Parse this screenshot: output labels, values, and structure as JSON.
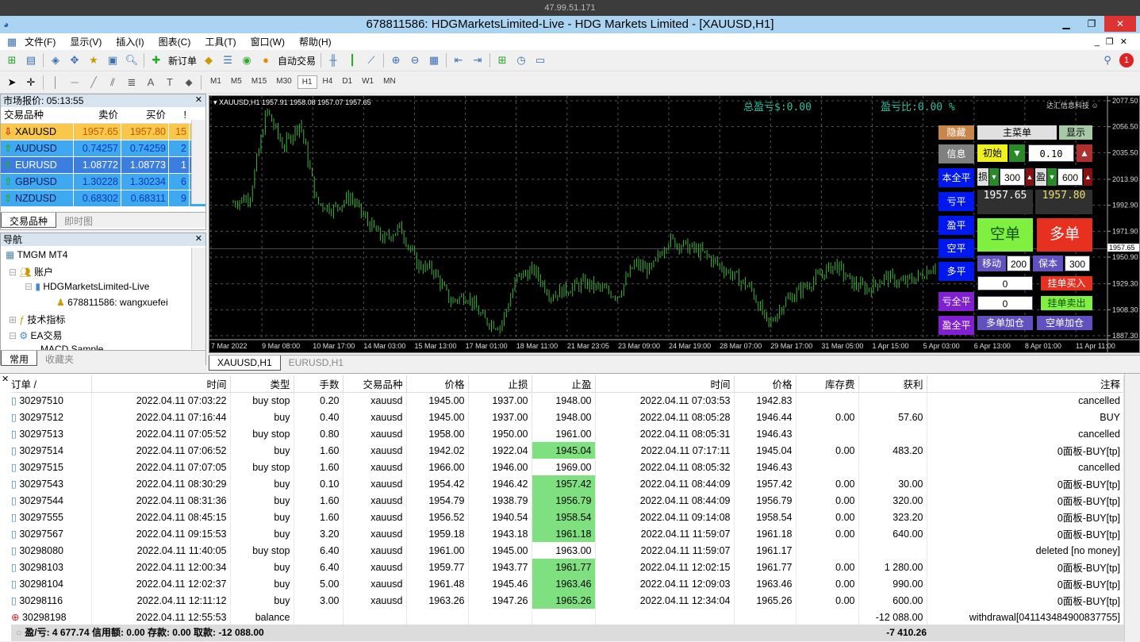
{
  "remote_ip": "47.99.51.171",
  "title": "678811586: HDGMarketsLimited-Live - HDG Markets Limited - [XAUUSD,H1]",
  "menu": [
    "文件(F)",
    "显示(V)",
    "插入(I)",
    "图表(C)",
    "工具(T)",
    "窗口(W)",
    "帮助(H)"
  ],
  "toolbar": {
    "new_order": "新订单",
    "auto_trade": "自动交易"
  },
  "timeframes": [
    "M1",
    "M5",
    "M15",
    "M30",
    "H1",
    "H4",
    "D1",
    "W1",
    "MN"
  ],
  "active_timeframe": "H1",
  "market_watch": {
    "title": "市场报价: 05:13:55",
    "headers": [
      "交易品种",
      "卖价",
      "买价",
      "!"
    ],
    "rows": [
      {
        "symbol": "XAUUSD",
        "bid": "1957.65",
        "ask": "1957.80",
        "spread": "15",
        "dir": "down"
      },
      {
        "symbol": "AUDUSD",
        "bid": "0.74257",
        "ask": "0.74259",
        "spread": "2",
        "dir": "up"
      },
      {
        "symbol": "EURUSD",
        "bid": "1.08772",
        "ask": "1.08773",
        "spread": "1",
        "dir": "up"
      },
      {
        "symbol": "GBPUSD",
        "bid": "1.30228",
        "ask": "1.30234",
        "spread": "6",
        "dir": "up"
      },
      {
        "symbol": "NZDUSD",
        "bid": "0.68302",
        "ask": "0.68311",
        "spread": "9",
        "dir": "up"
      }
    ],
    "tabs": [
      "交易品种",
      "即时图"
    ]
  },
  "navigator": {
    "title": "导航",
    "items": [
      "TMGM MT4",
      "账户",
      "HDGMarketsLimited-Live",
      "678811586: wangxuefei",
      "技术指标",
      "EA交易",
      "MACD Sample"
    ],
    "tabs": [
      "常用",
      "收藏夹"
    ]
  },
  "chart": {
    "info": "XAUUSD,H1  1957.91 1958.08 1957.07 1957.65",
    "total_pl": "总盈亏$:0.00",
    "pl_ratio": "盈亏比:0.00 %",
    "brand": "达汇信息科技",
    "price_axis": [
      "2077.50",
      "2056.50",
      "2035.50",
      "2013.90",
      "1992.90",
      "1971.90",
      "1950.90",
      "1929.30",
      "1908.30",
      "1887.30"
    ],
    "current_price": "1957.65",
    "time_axis": [
      "7 Mar 2022",
      "9 Mar 08:00",
      "10 Mar 17:00",
      "14 Mar 03:00",
      "15 Mar 13:00",
      "17 Mar 01:00",
      "18 Mar 11:00",
      "21 Mar 23:05",
      "23 Mar 09:00",
      "24 Mar 19:00",
      "28 Mar 07:00",
      "29 Mar 17:00",
      "31 Mar 05:00",
      "1 Apr 15:00",
      "5 Apr 03:00",
      "6 Apr 13:00",
      "8 Apr 01:00",
      "11 Apr 11:00"
    ],
    "price_path": [
      1995,
      2000,
      2070,
      2040,
      2060,
      1995,
      1990,
      2000,
      1980,
      1965,
      1975,
      1945,
      1940,
      1915,
      1920,
      1900,
      1895,
      1935,
      1940,
      1920,
      1925,
      1930,
      1925,
      1920,
      1945,
      1940,
      1965,
      1960,
      1955,
      1945,
      1935,
      1925,
      1895,
      1915,
      1925,
      1935,
      1945,
      1930,
      1925,
      1935,
      1930,
      1935,
      1945
    ]
  },
  "ea_panel": {
    "hide": "隐藏",
    "main_menu": "主菜单",
    "show": "显示",
    "info": "信息",
    "initial": "初始",
    "lots": "0.10",
    "close_all_self": "本全平",
    "sl_label": "损",
    "sl": "300",
    "tp_label": "盈",
    "tp": "600",
    "bid": "1957.65",
    "ask": "1957.80",
    "close_loss": "亏平",
    "close_profit": "盈平",
    "close_short": "空平",
    "close_long": "多平",
    "sell": "空单",
    "buy": "多单",
    "trail_label": "移动",
    "trail": "200",
    "breakeven_label": "保本",
    "breakeven": "300",
    "pending_buy_value": "0",
    "pending_buy": "挂单买入",
    "pending_sell_value": "0",
    "pending_sell": "挂单卖出",
    "close_all_loss": "亏全平",
    "close_all_profit": "盈全平",
    "add_long": "多单加仓",
    "add_short": "空单加仓"
  },
  "chart_tabs": [
    "XAUUSD,H1",
    "EURUSD,H1"
  ],
  "terminal": {
    "headers": [
      "订单  /",
      "时间",
      "类型",
      "手数",
      "交易品种",
      "价格",
      "止损",
      "止盈",
      "时间",
      "价格",
      "库存费",
      "获利",
      "注释"
    ],
    "rows": [
      [
        "30297510",
        "2022.04.11 07:03:22",
        "buy stop",
        "0.20",
        "xauusd",
        "1945.00",
        "1937.00",
        "1948.00",
        "2022.04.11 07:03:53",
        "1942.83",
        "",
        "",
        "cancelled",
        false
      ],
      [
        "30297512",
        "2022.04.11 07:16:44",
        "buy",
        "0.40",
        "xauusd",
        "1945.00",
        "1937.00",
        "1948.00",
        "2022.04.11 08:05:28",
        "1946.44",
        "0.00",
        "57.60",
        "BUY",
        false
      ],
      [
        "30297513",
        "2022.04.11 07:05:52",
        "buy stop",
        "0.80",
        "xauusd",
        "1958.00",
        "1950.00",
        "1961.00",
        "2022.04.11 08:05:31",
        "1946.43",
        "",
        "",
        "cancelled",
        false
      ],
      [
        "30297514",
        "2022.04.11 07:06:52",
        "buy",
        "1.60",
        "xauusd",
        "1942.02",
        "1922.04",
        "1945.04",
        "2022.04.11 07:17:11",
        "1945.04",
        "0.00",
        "483.20",
        "0面板-BUY[tp]",
        true
      ],
      [
        "30297515",
        "2022.04.11 07:07:05",
        "buy stop",
        "1.60",
        "xauusd",
        "1966.00",
        "1946.00",
        "1969.00",
        "2022.04.11 08:05:32",
        "1946.43",
        "",
        "",
        "cancelled",
        false
      ],
      [
        "30297543",
        "2022.04.11 08:30:29",
        "buy",
        "0.10",
        "xauusd",
        "1954.42",
        "1946.42",
        "1957.42",
        "2022.04.11 08:44:09",
        "1957.42",
        "0.00",
        "30.00",
        "0面板-BUY[tp]",
        true
      ],
      [
        "30297544",
        "2022.04.11 08:31:36",
        "buy",
        "1.60",
        "xauusd",
        "1954.79",
        "1938.79",
        "1956.79",
        "2022.04.11 08:44:09",
        "1956.79",
        "0.00",
        "320.00",
        "0面板-BUY[tp]",
        true
      ],
      [
        "30297555",
        "2022.04.11 08:45:15",
        "buy",
        "1.60",
        "xauusd",
        "1956.52",
        "1940.54",
        "1958.54",
        "2022.04.11 09:14:08",
        "1958.54",
        "0.00",
        "323.20",
        "0面板-BUY[tp]",
        true
      ],
      [
        "30297567",
        "2022.04.11 09:15:53",
        "buy",
        "3.20",
        "xauusd",
        "1959.18",
        "1943.18",
        "1961.18",
        "2022.04.11 11:59:07",
        "1961.18",
        "0.00",
        "640.00",
        "0面板-BUY[tp]",
        true
      ],
      [
        "30298080",
        "2022.04.11 11:40:05",
        "buy stop",
        "6.40",
        "xauusd",
        "1961.00",
        "1945.00",
        "1963.00",
        "2022.04.11 11:59:07",
        "1961.17",
        "",
        "",
        "deleted [no money]",
        false
      ],
      [
        "30298103",
        "2022.04.11 12:00:34",
        "buy",
        "6.40",
        "xauusd",
        "1959.77",
        "1943.77",
        "1961.77",
        "2022.04.11 12:02:15",
        "1961.77",
        "0.00",
        "1 280.00",
        "0面板-BUY[tp]",
        true
      ],
      [
        "30298104",
        "2022.04.11 12:02:37",
        "buy",
        "5.00",
        "xauusd",
        "1961.48",
        "1945.46",
        "1963.46",
        "2022.04.11 12:09:03",
        "1963.46",
        "0.00",
        "990.00",
        "0面板-BUY[tp]",
        true
      ],
      [
        "30298116",
        "2022.04.11 12:11:12",
        "buy",
        "3.00",
        "xauusd",
        "1963.26",
        "1947.26",
        "1965.26",
        "2022.04.11 12:34:04",
        "1965.26",
        "0.00",
        "600.00",
        "0面板-BUY[tp]",
        true
      ],
      [
        "30298198",
        "2022.04.11 12:55:53",
        "balance",
        "",
        "",
        "",
        "",
        "",
        "",
        "",
        "",
        "-12 088.00",
        "withdrawal[041143484900837755]",
        false
      ]
    ],
    "footer": "盈/亏: 4 677.74  信用额: 0.00  存款: 0.00  取款: -12 088.00",
    "footer_profit": "-7 410.26"
  },
  "colors": {
    "chart_bg": "#000000",
    "candle": "#3cb43c",
    "buy_btn": "#e83020",
    "sell_btn": "#80f040",
    "tp_hit": "#7ee07e"
  }
}
